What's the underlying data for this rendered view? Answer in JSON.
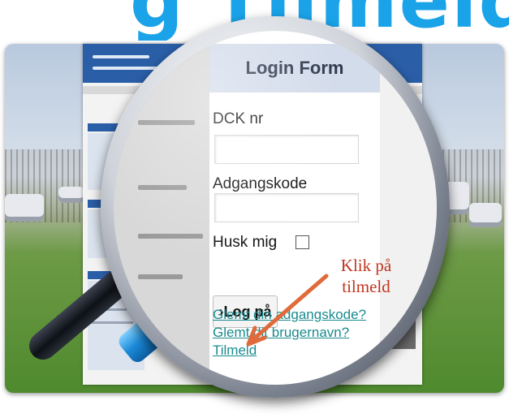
{
  "banner": {
    "text": "g Tilmeldings side"
  },
  "login_form": {
    "title": "Login Form",
    "dck_label": "DCK nr",
    "dck_value": "",
    "password_label": "Adgangskode",
    "password_value": "",
    "remember_label": "Husk mig",
    "login_button": "›Log på",
    "links": [
      "Glemt din adgangskode?",
      "Glemt dit brugernavn?",
      "Tilmeld"
    ]
  },
  "annotation": {
    "line1": "Klik på",
    "line2": "tilmeld"
  },
  "colors": {
    "banner": "#1aa3e8",
    "site_header": "#2a5fa8",
    "annotation": "#c2351f",
    "link": "#1a8b8f"
  }
}
